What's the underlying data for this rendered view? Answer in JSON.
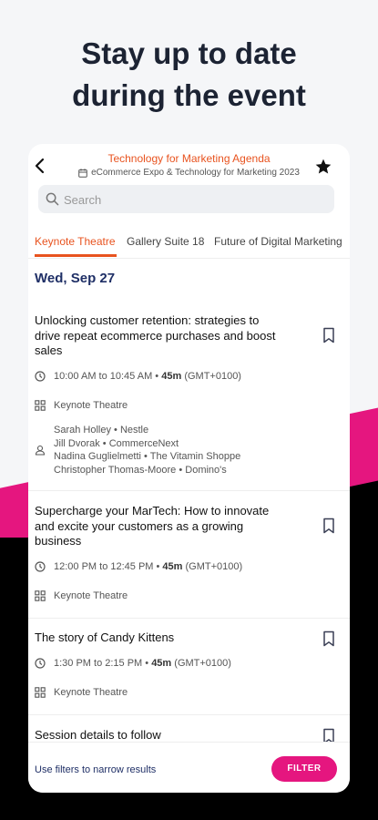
{
  "headline": {
    "line1": "Stay up to date",
    "line2": "during the event"
  },
  "app": {
    "title": "Technology for Marketing Agenda",
    "subtitle": "eCommerce Expo & Technology for Marketing 2023"
  },
  "search": {
    "placeholder": "Search"
  },
  "tabs": [
    {
      "label": "Keynote Theatre",
      "active": true
    },
    {
      "label": "Gallery Suite 18",
      "active": false
    },
    {
      "label": "Future of Digital Marketing",
      "active": false
    }
  ],
  "date_heading": "Wed, Sep 27",
  "sessions": [
    {
      "title_lines": [
        "Unlocking customer retention: strategies to",
        "drive repeat ecommerce purchases and boost",
        "sales"
      ],
      "time": "10:00 AM to 10:45 AM •",
      "duration": "45m",
      "timezone": "(GMT+0100)",
      "location": "Keynote Theatre",
      "speakers": [
        "Sarah Holley • Nestle",
        "Jill Dvorak • CommerceNext",
        "Nadina Guglielmetti • The Vitamin Shoppe",
        "Christopher Thomas-Moore • Domino's"
      ]
    },
    {
      "title_lines": [
        "Supercharge your MarTech: How to innovate",
        "and excite your customers as a growing",
        "business"
      ],
      "time": "12:00 PM to 12:45 PM •",
      "duration": "45m",
      "timezone": "(GMT+0100)",
      "location": "Keynote Theatre"
    },
    {
      "title_lines": [
        "The story of Candy Kittens"
      ],
      "time": "1:30 PM to 2:15 PM •",
      "duration": "45m",
      "timezone": "(GMT+0100)",
      "location": "Keynote Theatre"
    },
    {
      "title_lines": [
        "Session details to follow"
      ]
    }
  ],
  "footer": {
    "hint": "Use filters to narrow results",
    "filter_label": "FILTER"
  },
  "colors": {
    "accent_orange": "#e8531f",
    "brand_pink": "#e5167f",
    "navy": "#1f2f66"
  }
}
